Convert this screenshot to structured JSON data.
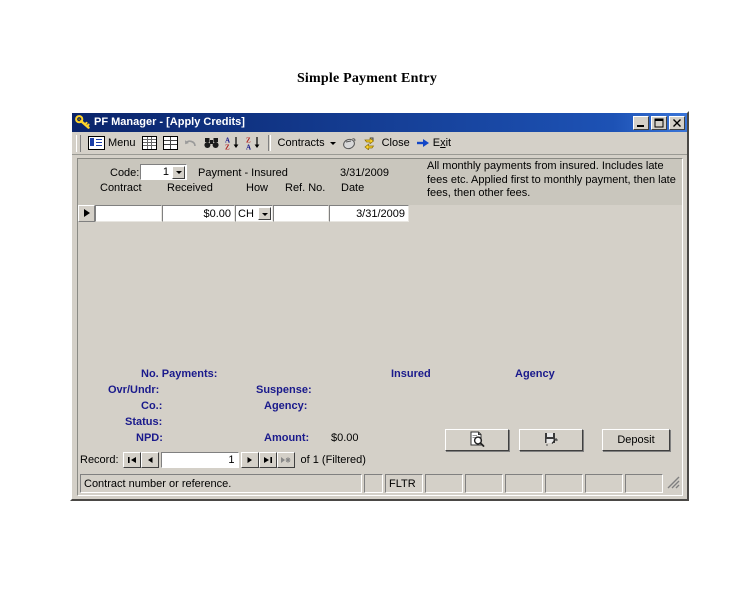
{
  "page": {
    "heading": "Simple Payment Entry"
  },
  "window": {
    "title": "PF Manager - [Apply Credits]",
    "icon": "key-icon",
    "controls": {
      "minimize": "_",
      "maximize": "□",
      "close": "✕"
    }
  },
  "toolbar": {
    "items": [
      {
        "label": "Menu",
        "icon": "menu-form-icon",
        "name": "toolbar-menu"
      },
      {
        "label": "",
        "icon": "datasheet-icon",
        "name": "toolbar-datasheet"
      },
      {
        "label": "",
        "icon": "table-view-icon",
        "name": "toolbar-table-view"
      },
      {
        "label": "",
        "icon": "undo-icon",
        "name": "toolbar-undo"
      },
      {
        "label": "",
        "icon": "binoculars-find-icon",
        "name": "toolbar-find"
      },
      {
        "label": "",
        "icon": "sort-ascending-icon",
        "name": "toolbar-sort-asc"
      },
      {
        "label": "",
        "icon": "sort-descending-icon",
        "name": "toolbar-sort-desc"
      },
      {
        "label": "Contracts",
        "icon": "chevron-down-icon",
        "name": "toolbar-contracts"
      },
      {
        "label": "",
        "icon": "mouse-icon",
        "name": "toolbar-mouse"
      },
      {
        "label": "",
        "icon": "refresh-icon",
        "name": "toolbar-refresh"
      },
      {
        "label": "Close",
        "icon": "",
        "name": "toolbar-close"
      },
      {
        "label": "Exit",
        "icon": "exit-arrow-icon",
        "name": "toolbar-exit"
      }
    ],
    "menu_label": "Menu",
    "contracts_label": "Contracts",
    "close_label": "Close",
    "exit_label_pre": "E",
    "exit_label_accel": "x",
    "exit_label_post": "it"
  },
  "form_header": {
    "code_label": "Code:",
    "code_value": "1",
    "code_description": "Payment - Insured",
    "header_date": "3/31/2009",
    "description_text": "All monthly payments from insured.  Includes late fees etc.  Applied first to monthly payment, then late fees, then other fees."
  },
  "grid": {
    "columns": [
      "Contract",
      "Received",
      "How",
      "Ref. No.",
      "Date"
    ],
    "rows": [
      {
        "contract": "",
        "received": "$0.00",
        "how": "CH",
        "ref_no": "",
        "date": "3/31/2009"
      }
    ]
  },
  "summary": {
    "col_insured": "Insured",
    "col_agency": "Agency",
    "no_payments_label": "No. Payments:",
    "no_payments_value": "",
    "ovr_undr_label": "Ovr/Undr:",
    "ovr_undr_value": "",
    "suspense_label": "Suspense:",
    "suspense_value": "",
    "co_label": "Co.:",
    "co_value": "",
    "agency_label": "Agency:",
    "agency_value": "",
    "status_label": "Status:",
    "status_value": "",
    "npd_label": "NPD:",
    "npd_value": "",
    "amount_label": "Amount:",
    "amount_value": "$0.00"
  },
  "actions": {
    "preview_icon": "preview-document-icon",
    "save_icon": "save-edit-icon",
    "deposit_label": "Deposit"
  },
  "record_nav": {
    "label": "Record:",
    "first_icon": "first-record-icon",
    "prev_icon": "previous-record-icon",
    "current": "1",
    "next_icon": "next-record-icon",
    "last_icon": "last-record-icon",
    "new_icon": "new-record-icon",
    "of_text": "of  1 (Filtered)"
  },
  "status_bar": {
    "message": "Contract number or reference.",
    "filter_indicator": "FLTR",
    "panels": [
      "",
      "",
      "",
      "",
      "",
      ""
    ]
  },
  "colors": {
    "window_face": "#d4d0c8",
    "title_bar_start": "#0a246a",
    "title_bar_end": "#3a75d8",
    "label_blue": "#1a1a8c",
    "header_band": "#c9c6bd"
  }
}
